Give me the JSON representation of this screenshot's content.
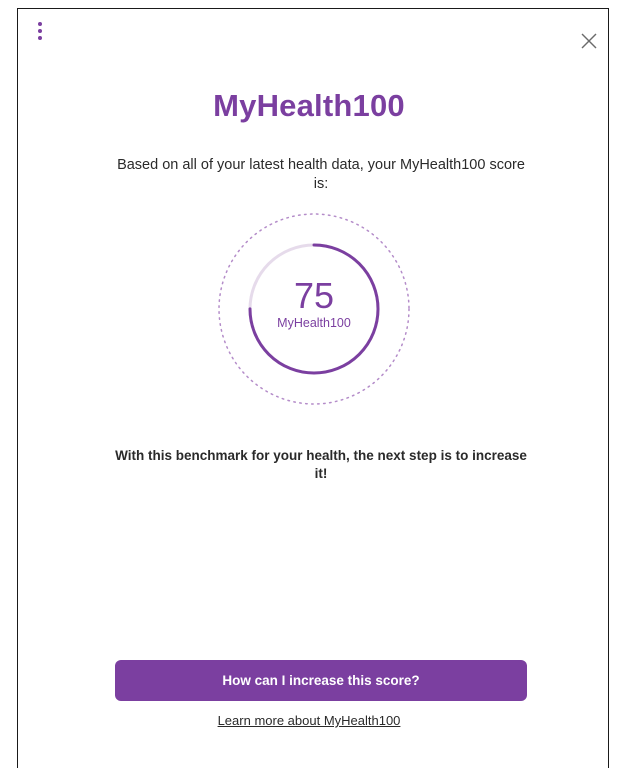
{
  "header": {
    "menu_icon": "more-vertical-icon",
    "close_icon": "close-icon"
  },
  "title": "MyHealth100",
  "subtitle": "Based on all of your latest health data, your MyHealth100 score is:",
  "score": {
    "value": "75",
    "label": "MyHealth100",
    "max": 100
  },
  "benchmark_text": "With this benchmark for your health, the next step is to increase it!",
  "cta_label": "How can I increase this score?",
  "learn_more_label": "Learn more about MyHealth100",
  "colors": {
    "accent": "#7b3fa0",
    "track": "#e6dbeb",
    "text": "#2a2a2a"
  }
}
